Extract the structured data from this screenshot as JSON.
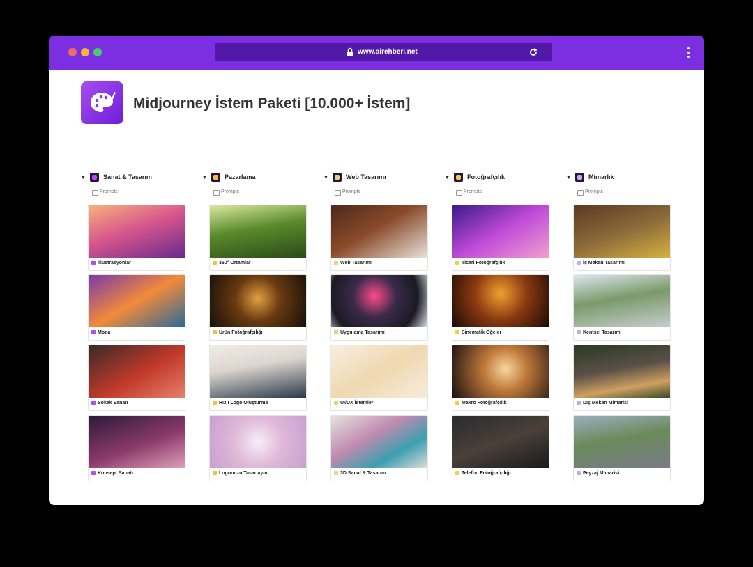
{
  "browser": {
    "url": "www.airehberi.net",
    "lock_icon": "lock-icon",
    "reload_icon": "reload-icon",
    "menu_icon": "vertical-dots-icon"
  },
  "page": {
    "title": "Midjourney İstem Paketi [10.000+ İstem]",
    "logo_icon": "palette-brush-icon",
    "accent": "#7b2fe0"
  },
  "columns": [
    {
      "title": "Sanat & Tasarım",
      "icon_color": "#b04cf0",
      "view": "Prompts",
      "cards": [
        {
          "label": "İllüstrasyonlar",
          "bg": "linear-gradient(160deg,#f7b27a 0%,#d8578c 45%,#6a2a8c 100%)"
        },
        {
          "label": "Moda",
          "bg": "linear-gradient(150deg,#7a3aa8 0%,#f28a3a 50%,#2a6a9a 100%)"
        },
        {
          "label": "Sokak Sanatı",
          "bg": "linear-gradient(150deg,#3a2a28 0%,#c23a2a 55%,#e6806a 100%)"
        },
        {
          "label": "Konsept Sanatı",
          "bg": "linear-gradient(160deg,#2a1a3a 0%,#8a3a6a 55%,#e0a0b8 100%)"
        }
      ]
    },
    {
      "title": "Pazarlama",
      "icon_color": "#f0c040",
      "view": "Prompts",
      "cards": [
        {
          "label": "360° Ortamlar",
          "bg": "linear-gradient(170deg,#d8e8a0 0%,#5a8a2a 45%,#2a4a1a 100%)"
        },
        {
          "label": "Ürün Fotoğrafçılığı",
          "bg": "radial-gradient(circle at 50% 45%,#e0a040 0%,#6a3a10 40%,#141008 100%)"
        },
        {
          "label": "Hızlı Logo Oluşturma",
          "bg": "linear-gradient(170deg,#f0ece6 0%,#dcd6ce 40%,#2a3a4a 100%)"
        },
        {
          "label": "Logonuzu Tasarlayın",
          "bg": "radial-gradient(circle at 50% 50%,#f6eef6 0%,#e0b8d8 45%,#c8a0d0 100%)"
        }
      ]
    },
    {
      "title": "Web Tasarımı",
      "icon_color": "#e8d080",
      "view": "Prompts",
      "cards": [
        {
          "label": "Web Tasarımı",
          "bg": "linear-gradient(150deg,#4a2a1a 0%,#8a4a2a 45%,#e8e2da 100%)"
        },
        {
          "label": "Uygulama Tasarımı",
          "bg": "radial-gradient(circle at 45% 40%,#ff4a8a 0%,#3a2a4a 35%,#1a1a22 70%,#e0e4ea 100%)"
        },
        {
          "label": "UI/UX İstemleri",
          "bg": "linear-gradient(150deg,#f6efe2 0%,#f0d8b0 50%,#f6ecdc 100%)"
        },
        {
          "label": "3D Sanat & Tasarım",
          "bg": "linear-gradient(150deg,#e6e2de 0%,#c08ab0 40%,#3aa0b0 70%,#e0dcd8 100%)"
        }
      ]
    },
    {
      "title": "Fotoğrafçılık",
      "icon_color": "#f0d040",
      "view": "Prompts",
      "cards": [
        {
          "label": "Ticari Fotoğrafçılık",
          "bg": "linear-gradient(150deg,#3a1a8a 0%,#c04ad8 50%,#f0a0d0 100%)"
        },
        {
          "label": "Sinematik Öğeler",
          "bg": "radial-gradient(circle at 50% 35%,#f0a030 0%,#8a3a10 45%,#1a0a06 100%)"
        },
        {
          "label": "Makro Fotoğrafçılık",
          "bg": "radial-gradient(circle at 55% 45%,#f6d8a0 0%,#c07a3a 35%,#1a1010 100%)"
        },
        {
          "label": "Telefon Fotoğrafçılığı",
          "bg": "linear-gradient(160deg,#2a2a30 0%,#4a4038 50%,#1a1a1e 100%)"
        }
      ]
    },
    {
      "title": "Mimarlık",
      "icon_color": "#c0b0e0",
      "view": "Prompts",
      "cards": [
        {
          "label": "İç Mekan Tasarımı",
          "bg": "linear-gradient(160deg,#5a3a22 0%,#8a6a3a 50%,#d8b040 100%)"
        },
        {
          "label": "Kentsel Tasarım",
          "bg": "linear-gradient(170deg,#dce6ee 0%,#7a9a6a 45%,#c8ccd0 100%)"
        },
        {
          "label": "Dış Mekan Mimarisi",
          "bg": "linear-gradient(170deg,#2a3a22 0%,#5a5048 45%,#d0a060 75%,#3a4a2a 100%)"
        },
        {
          "label": "Peyzaj Mimarisi",
          "bg": "linear-gradient(170deg,#9ab0c0 0%,#6a8a5a 45%,#7a7a88 100%)"
        }
      ]
    }
  ]
}
